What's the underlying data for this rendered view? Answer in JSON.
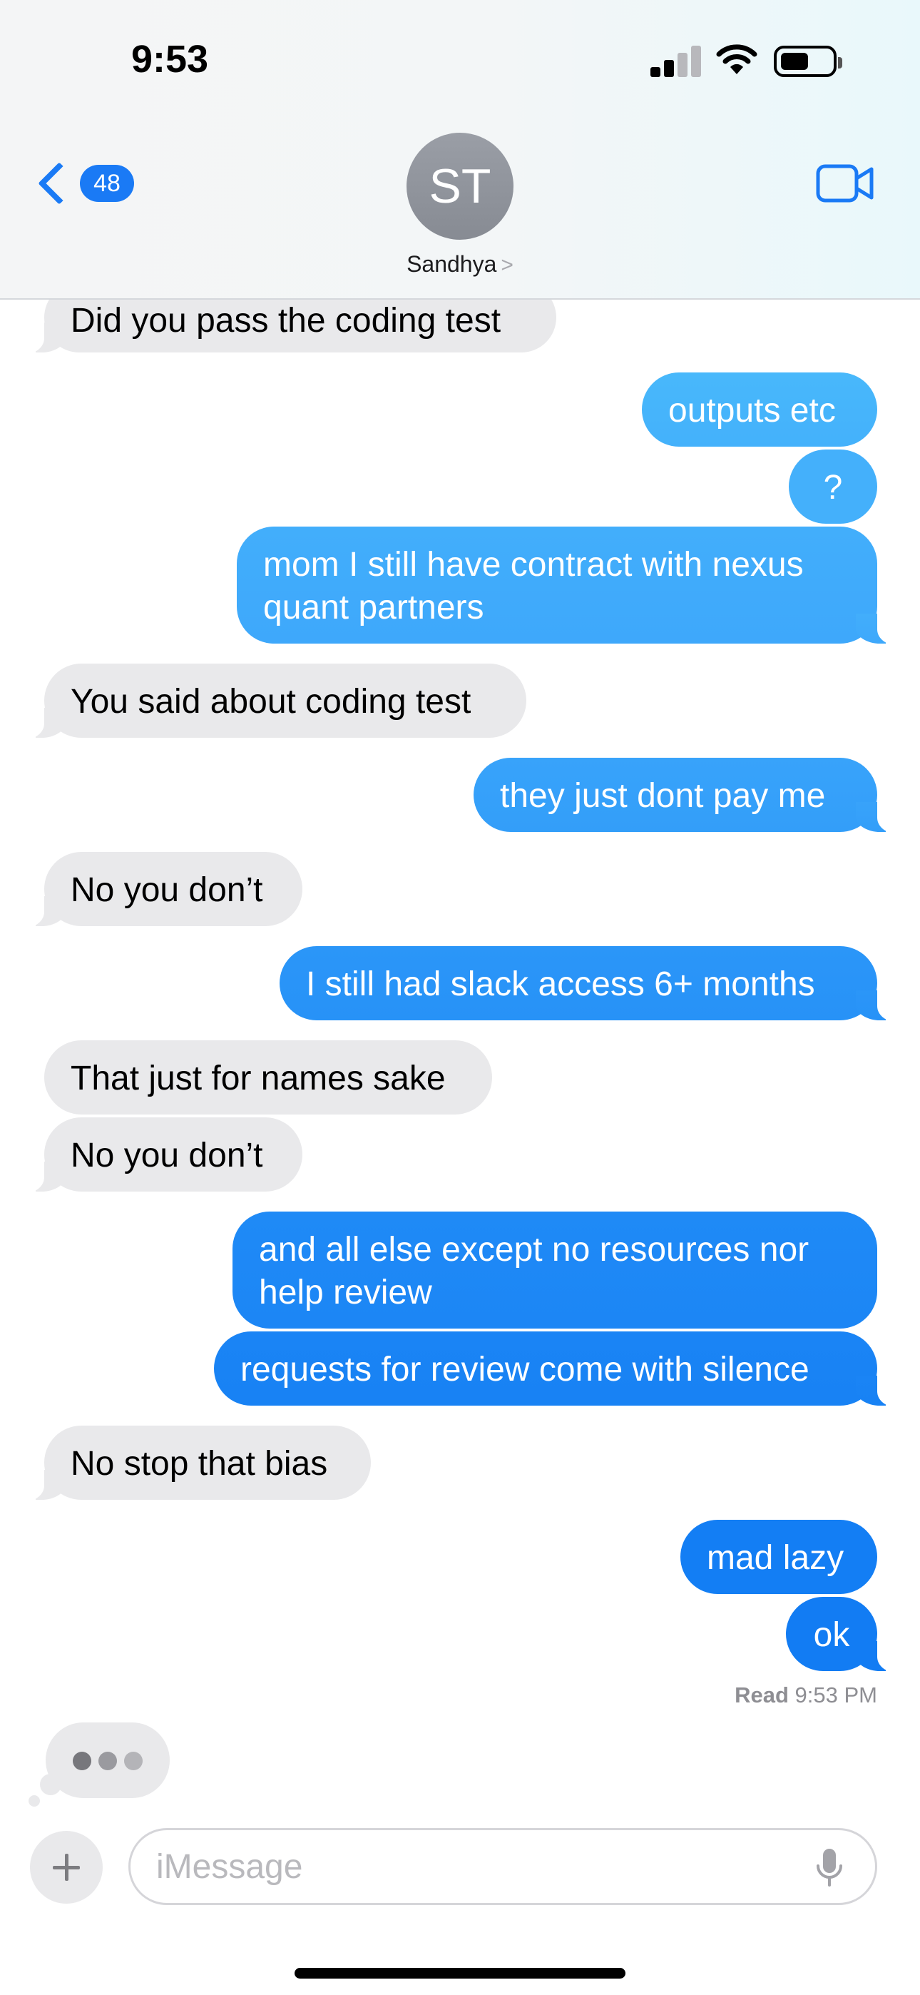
{
  "status_bar": {
    "time": "9:53"
  },
  "header": {
    "back_count": "48",
    "avatar_initials": "ST",
    "contact_name": "Sandhya",
    "contact_arrow": ">"
  },
  "messages": [
    {
      "from": "them",
      "text": "Did you pass the coding test"
    },
    {
      "from": "me",
      "text": "outputs etc"
    },
    {
      "from": "me",
      "text": "?"
    },
    {
      "from": "me",
      "text": "mom I still have contract with nexus",
      "text2": "quant partners"
    },
    {
      "from": "them",
      "text": "You said about coding test"
    },
    {
      "from": "me",
      "text": "they just dont pay me"
    },
    {
      "from": "them",
      "text": "No you don’t"
    },
    {
      "from": "me",
      "text": "I still had slack access 6+ months"
    },
    {
      "from": "them",
      "text": "That just for names sake"
    },
    {
      "from": "them",
      "text": "No you don’t"
    },
    {
      "from": "me",
      "text": "and all else except no resources nor",
      "text2": "help review"
    },
    {
      "from": "me",
      "text": "requests for review come with silence"
    },
    {
      "from": "them",
      "text": "No stop that bias"
    },
    {
      "from": "me",
      "text": "mad lazy"
    },
    {
      "from": "me",
      "text": "ok"
    }
  ],
  "read_receipt": {
    "label": "Read",
    "time": "9:53 PM"
  },
  "input_bar": {
    "placeholder": "iMessage"
  },
  "colors": {
    "incoming_bubble": "#e9e9eb",
    "sms_gradient_top": "#48b8fb",
    "sms_gradient_bottom": "#0c78f2",
    "accent": "#1a7af5"
  }
}
